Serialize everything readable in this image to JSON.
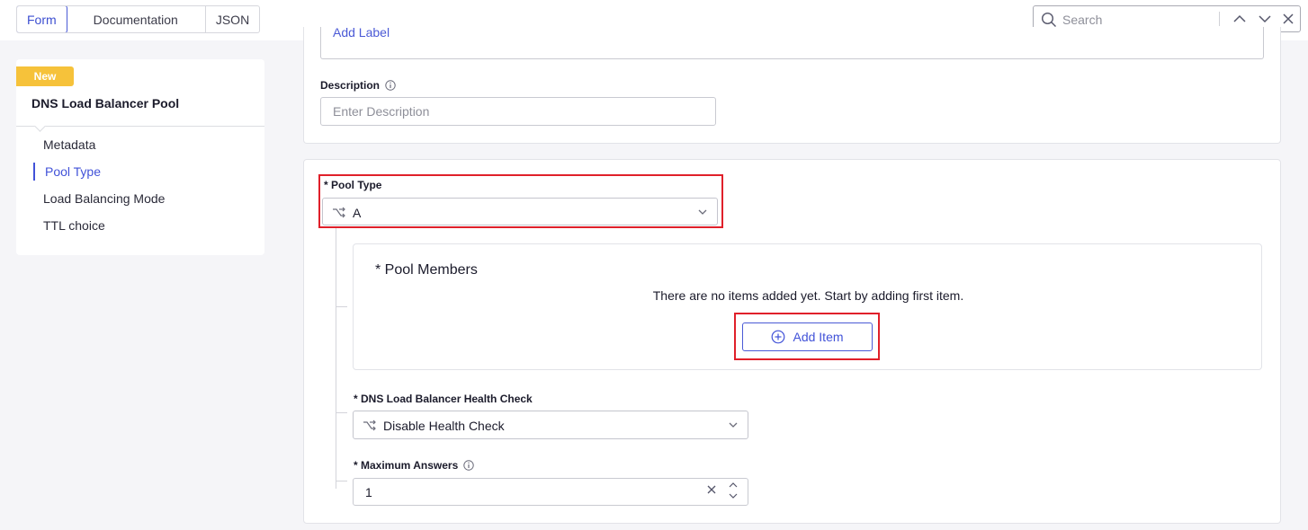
{
  "tabs": [
    {
      "label": "Form",
      "active": true
    },
    {
      "label": "Documentation",
      "active": false
    },
    {
      "label": "JSON",
      "active": false
    }
  ],
  "search": {
    "placeholder": "Search"
  },
  "sidebar": {
    "badge": "New",
    "title": "DNS Load Balancer Pool",
    "items": [
      {
        "label": "Metadata",
        "active": false
      },
      {
        "label": "Pool Type",
        "active": true
      },
      {
        "label": "Load Balancing Mode",
        "active": false
      },
      {
        "label": "TTL choice",
        "active": false
      }
    ]
  },
  "metadata": {
    "add_label": "Add Label",
    "description_label": "Description",
    "description_placeholder": "Enter Description"
  },
  "pool_type": {
    "label": "* Pool Type",
    "value": "A"
  },
  "pool_members": {
    "title": "*  Pool Members",
    "empty_text": "There are no items added yet. Start by adding first item.",
    "add_button": "Add Item"
  },
  "health_check": {
    "label": "* DNS Load Balancer Health Check",
    "value": "Disable Health Check"
  },
  "max_answers": {
    "label": "* Maximum Answers",
    "value": "1"
  },
  "colors": {
    "accent": "#4152d8",
    "badge": "#f6c23a",
    "highlight": "#e0202a"
  }
}
